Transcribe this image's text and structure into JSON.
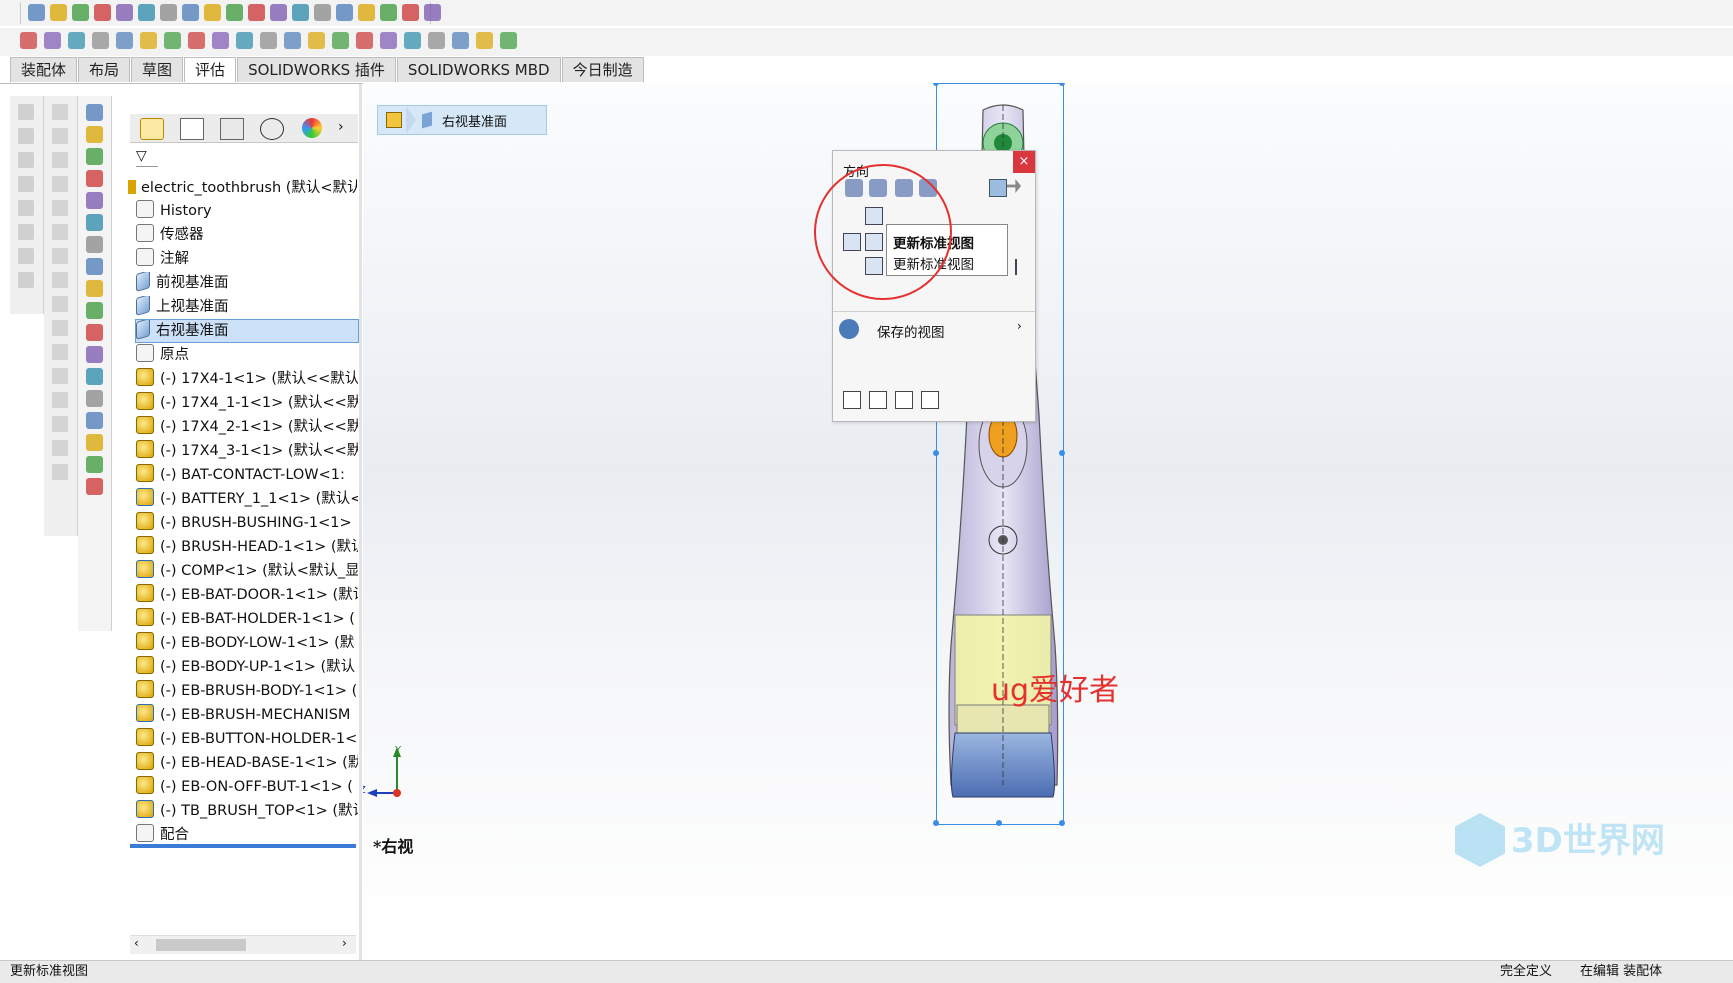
{
  "tabs": [
    "装配体",
    "布局",
    "草图",
    "评估",
    "SOLIDWORKS 插件",
    "SOLIDWORKS MBD",
    "今日制造"
  ],
  "active_tab_index": 3,
  "breadcrumb": {
    "label": "右视基准面"
  },
  "tree": {
    "root": "electric_toothbrush  (默认<默认",
    "items": [
      {
        "label": "History",
        "icon": "history-icon"
      },
      {
        "label": "传感器",
        "icon": "sensor-icon"
      },
      {
        "label": "注解",
        "icon": "annotation-icon"
      },
      {
        "label": "前视基准面",
        "icon": "plane-icon"
      },
      {
        "label": "上视基准面",
        "icon": "plane-icon"
      },
      {
        "label": "右视基准面",
        "icon": "plane-icon",
        "selected": true
      },
      {
        "label": "原点",
        "icon": "origin-icon"
      },
      {
        "label": "(-) 17X4-1<1> (默认<<默认",
        "icon": "part-icon"
      },
      {
        "label": "(-) 17X4_1-1<1> (默认<<默",
        "icon": "part-icon"
      },
      {
        "label": "(-) 17X4_2-1<1> (默认<<默",
        "icon": "part-icon"
      },
      {
        "label": "(-) 17X4_3-1<1> (默认<<默",
        "icon": "part-icon"
      },
      {
        "label": "(-) BAT-CONTACT-LOW<1:",
        "icon": "part-icon"
      },
      {
        "label": "(-) BATTERY_1_1<1> (默认<",
        "icon": "assembly-icon"
      },
      {
        "label": "(-) BRUSH-BUSHING-1<1>",
        "icon": "part-icon"
      },
      {
        "label": "(-) BRUSH-HEAD-1<1> (默认",
        "icon": "part-icon"
      },
      {
        "label": "(-) COMP<1> (默认<默认_显",
        "icon": "assembly-icon"
      },
      {
        "label": "(-) EB-BAT-DOOR-1<1> (默认",
        "icon": "part-icon"
      },
      {
        "label": "(-) EB-BAT-HOLDER-1<1> (",
        "icon": "part-icon"
      },
      {
        "label": "(-) EB-BODY-LOW-1<1> (默",
        "icon": "part-icon"
      },
      {
        "label": "(-) EB-BODY-UP-1<1> (默认",
        "icon": "part-icon"
      },
      {
        "label": "(-) EB-BRUSH-BODY-1<1> (",
        "icon": "part-icon"
      },
      {
        "label": "(-) EB-BRUSH-MECHANISM",
        "icon": "assembly-icon"
      },
      {
        "label": "(-) EB-BUTTON-HOLDER-1<",
        "icon": "part-icon"
      },
      {
        "label": "(-) EB-HEAD-BASE-1<1> (默",
        "icon": "part-icon"
      },
      {
        "label": "(-) EB-ON-OFF-BUT-1<1> (",
        "icon": "part-icon"
      },
      {
        "label": "(-) TB_BRUSH_TOP<1> (默认",
        "icon": "assembly-icon"
      },
      {
        "label": "配合",
        "icon": "mates-icon"
      }
    ]
  },
  "orientation_popup": {
    "title": "方向",
    "tooltip_bold": "更新标准视图",
    "tooltip_plain": "更新标准视图",
    "saved_views": "保存的视图"
  },
  "viewport": {
    "view_label": "*右视",
    "watermark": "ug爱好者",
    "logo_text": "3D世界网",
    "axis_y": "Y",
    "axis_z": "Z"
  },
  "status": {
    "left": "更新标准视图",
    "right1": "完全定义",
    "right2": "在编辑 装配体"
  },
  "colors": {
    "annotation_red": "#e53030",
    "selection_blue": "#3a8ee6"
  }
}
